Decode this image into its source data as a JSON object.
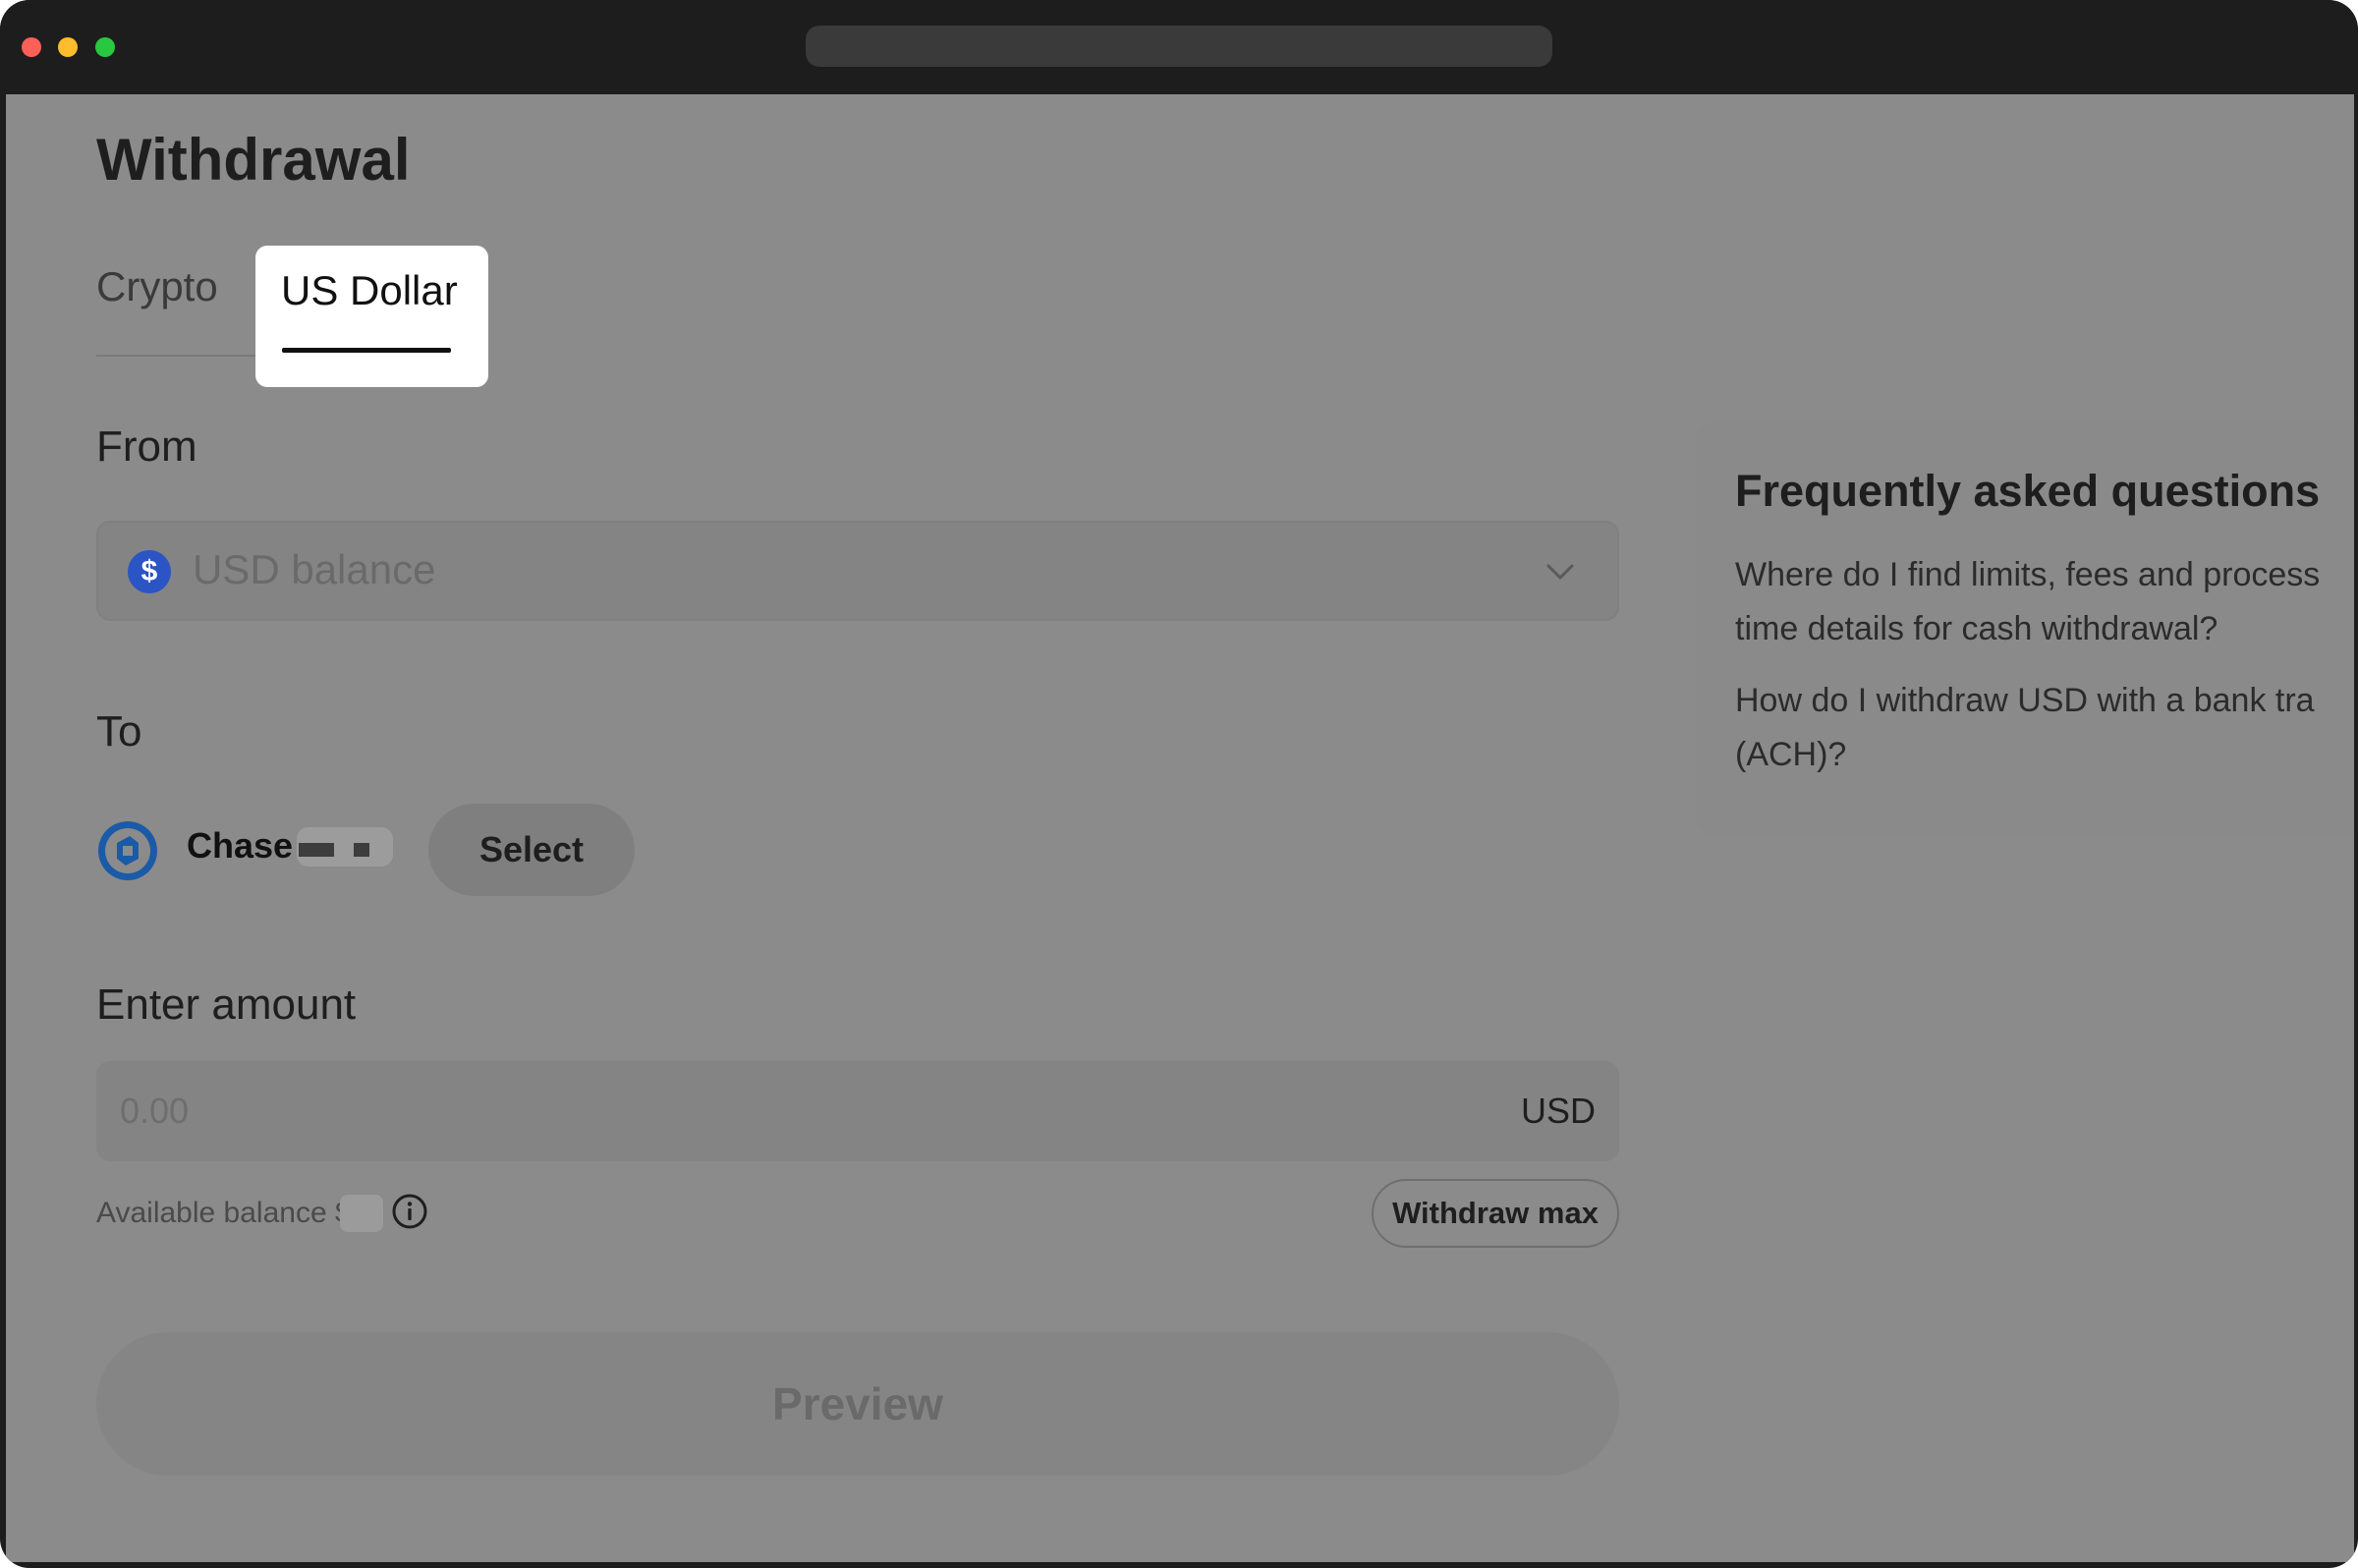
{
  "page": {
    "title": "Withdrawal"
  },
  "tabs": [
    {
      "label": "Crypto",
      "active": false
    },
    {
      "label": "US Dollar",
      "active": true
    }
  ],
  "from": {
    "label": "From",
    "account_icon": "dollar-coin-icon",
    "account": "USD balance",
    "dropdown_icon": "chevron-down-icon"
  },
  "to": {
    "label": "To",
    "bank_icon": "chase-bank-icon",
    "bank_name": "Chase",
    "select_label": "Select"
  },
  "amount": {
    "label": "Enter amount",
    "placeholder": "0.00",
    "currency": "USD",
    "available_label": "Available balance $",
    "info_icon": "info-icon",
    "withdraw_max_label": "Withdraw max"
  },
  "preview_label": "Preview",
  "faq": {
    "title": "Frequently asked questions",
    "questions": [
      "Where do I find limits, fees and process\ntime details for cash withdrawal?",
      "How do I withdraw USD with a bank tra\n(ACH)?"
    ]
  },
  "colors": {
    "overlay": "#8b8b8b",
    "active_tab_bg": "#ffffff",
    "usd_coin": "#2b54c5",
    "chase_blue": "#1b5aa7"
  }
}
